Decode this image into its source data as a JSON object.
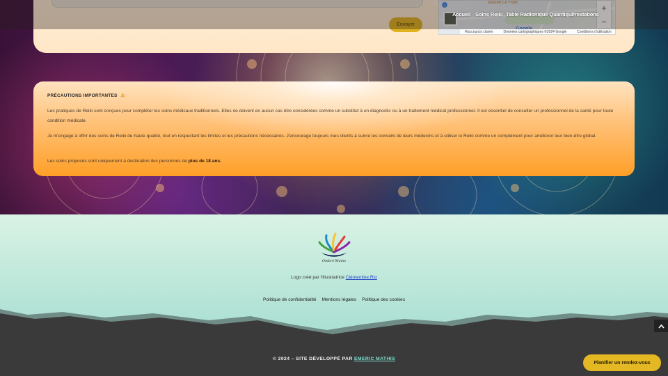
{
  "contact_form": {
    "send_label": "Envoyer"
  },
  "map": {
    "poi_text": "Maison Le Flore",
    "google_label": "Google",
    "zoom_in": "+",
    "zoom_out": "−",
    "attribution": {
      "shortcuts": "Raccourcis clavier",
      "data": "Données cartographiques ©2024 Google",
      "terms": "Conditions d'utilisation"
    }
  },
  "nav": {
    "items": [
      "Accueil",
      "Soins Reiki",
      "Table Radionique Quantique",
      "Prestations"
    ]
  },
  "precautions": {
    "title": "PRÉCAUTIONS IMPORTANTES",
    "warning_icon": "⚠",
    "p1": "Les pratiques de Reiki sont conçues pour compléter les soins médicaux traditionnels. Elles ne doivent en aucun cas être considérées comme un substitut à un diagnostic ou à un traitement médical professionnel. Il est essentiel de consulter un professionnel de la santé pour toute condition médicale.",
    "p2": "Je m'engage à offrir des soins de Reiki de haute qualité, tout en respectant les limites et les précautions nécessaires. J'encourage toujours mes clients à suivre les conseils de leurs médecins et à utiliser le Reiki comme un complément pour améliorer leur bien-être global.",
    "p3_prefix": "Les soins proposés sont uniquement à destination des personnes de ",
    "p3_bold": "plus de 18 ans."
  },
  "footer": {
    "logo_text": "Ombre'Mains",
    "credit_prefix": "Logo créé par l'illustratrice ",
    "credit_link": "Clémentine Rio",
    "legal": [
      "Politique de confidentialité",
      "Mentions légales",
      "Politique des cookies"
    ],
    "copyright_prefix": "© 2024 – SITE DÉVELOPPÉ PAR ",
    "copyright_link": "EMERIC MATHIS"
  },
  "floating": {
    "scroll_top_icon": "chevron-up",
    "rdv_label": "Planifier un rendez-vous"
  },
  "colors": {
    "accent": "#e4b823",
    "footer_dark": "#3a3a3a",
    "link": "#2a48c8"
  }
}
